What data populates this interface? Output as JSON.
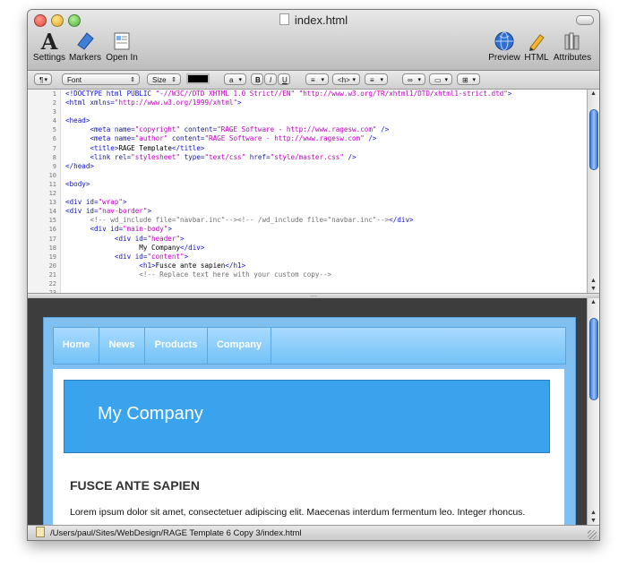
{
  "window": {
    "title": "index.html"
  },
  "toolbar": {
    "left": [
      {
        "label": "Settings",
        "icon": "font-a-icon"
      },
      {
        "label": "Markers",
        "icon": "marker-icon"
      },
      {
        "label": "Open In",
        "icon": "open-in-icon"
      }
    ],
    "right": [
      {
        "label": "Preview",
        "icon": "globe-icon"
      },
      {
        "label": "HTML",
        "icon": "pencil-icon"
      },
      {
        "label": "Attributes",
        "icon": "books-icon"
      }
    ]
  },
  "format_bar": {
    "paragraph": "¶",
    "font": "Font",
    "size": "Size",
    "color": "#000000",
    "case": "a",
    "bold": "B",
    "italic": "I",
    "underline": "U",
    "align": "≡",
    "heading": "<h>",
    "list": "≡"
  },
  "editor": {
    "line_numbers": [
      "1",
      "2",
      "3",
      "4",
      "5",
      "6",
      "7",
      "8",
      "9",
      "10",
      "11",
      "12",
      "13",
      "14",
      "15",
      "16",
      "17",
      "18",
      "19",
      "20",
      "21",
      "22",
      "23"
    ],
    "lines": [
      "<!DOCTYPE html PUBLIC \"-//W3C//DTD XHTML 1.0 Strict//EN\" \"http://www.w3.org/TR/xhtml1/DTD/xhtml1-strict.dtd\">",
      "<html xmlns=\"http://www.w3.org/1999/xhtml\">",
      "",
      "<head>",
      "      <meta name=\"copyright\" content=\"RAGE Software - http://www.ragesw.com\" />",
      "      <meta name=\"author\" content=\"RAGE Software - http://www.ragesw.com\" />",
      "      <title>RAGE Template</title>",
      "      <link rel=\"stylesheet\" type=\"text/css\" href=\"style/master.css\" />",
      "</head>",
      "",
      "<body>",
      "",
      "<div id=\"wrap\">",
      "<div id=\"nav-border\">",
      "      <!-- wd_include file=\"navbar.inc\"--><!-- /wd_include file=\"navbar.inc\"--></div>",
      "      <div id=\"main-body\">",
      "            <div id=\"header\">",
      "                  My Company</div>",
      "            <div id=\"content\">",
      "                  <h1>Fusce ante sapien</h1>",
      "                  <!-- Replace text here with your custom copy-->",
      "",
      ""
    ]
  },
  "preview": {
    "nav": [
      "Home",
      "News",
      "Products",
      "Company"
    ],
    "header": "My Company",
    "heading": "FUSCE ANTE SAPIEN",
    "paragraph": "Lorem ipsum dolor sit amet, consectetuer adipiscing elit. Maecenas interdum fermentum leo. Integer rhoncus."
  },
  "status": {
    "path": "/Users/paul/Sites/WebDesign/RAGE Template 6 Copy 3/index.html"
  }
}
